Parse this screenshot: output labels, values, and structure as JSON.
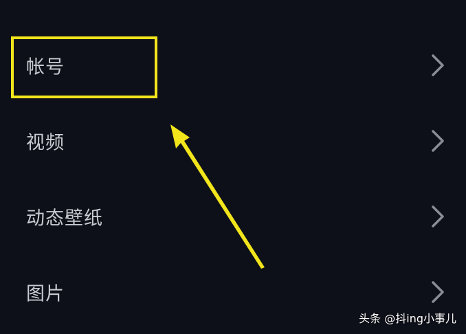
{
  "settings": {
    "items": [
      {
        "label": "帐号",
        "icon": "chevron-right-icon"
      },
      {
        "label": "视频",
        "icon": "chevron-right-icon"
      },
      {
        "label": "动态壁纸",
        "icon": "chevron-right-icon"
      },
      {
        "label": "图片",
        "icon": "chevron-right-icon"
      }
    ]
  },
  "annotation": {
    "highlight_color": "#f2e51b",
    "highlighted_item": "帐号"
  },
  "colors": {
    "background": "#0e1019",
    "label": "#c9cbd2",
    "chevron": "#8a8d96"
  },
  "watermark": {
    "text": "头条 @抖ing小事儿"
  }
}
